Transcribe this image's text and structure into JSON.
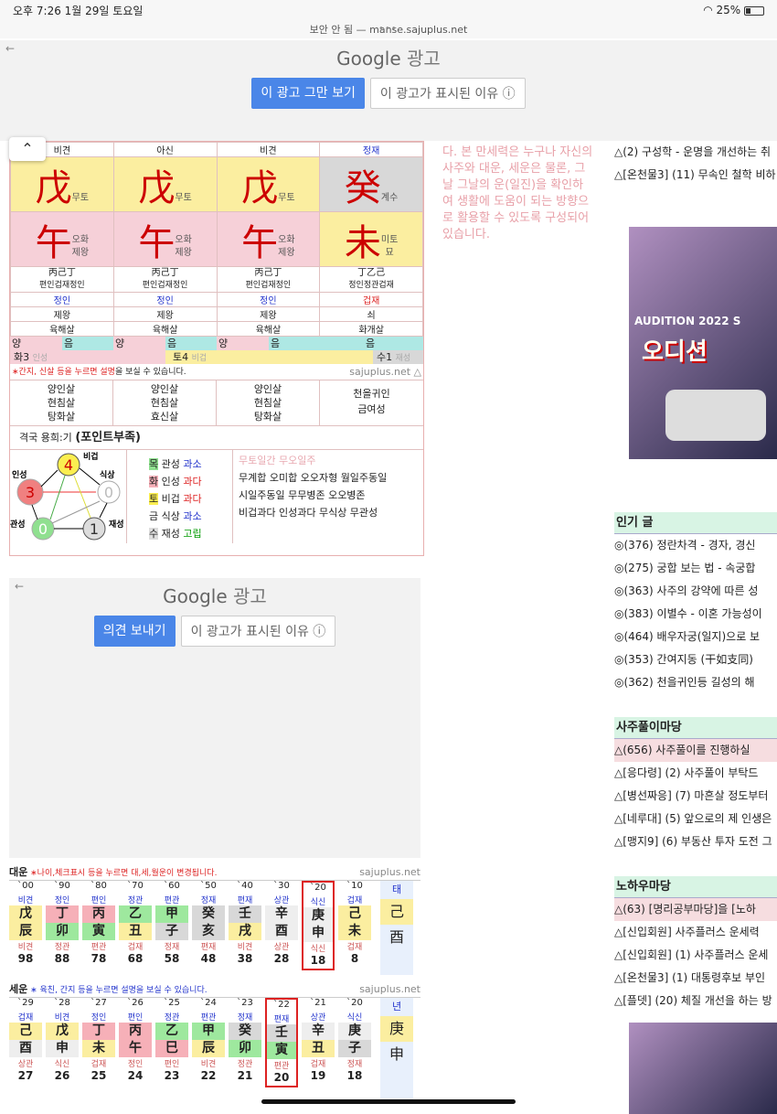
{
  "status": {
    "time": "오후 7:26",
    "date": "1월 29일 토요일",
    "battery": "25%",
    "wifi_icon": "wifi-icon"
  },
  "urlbar": {
    "text": "보안 안 됨 — manse.sajuplus.net"
  },
  "ad_top": {
    "google": "Google",
    "ad_label": "광고",
    "stop_button": "이 광고 그만 보기",
    "why_button": "이 광고가 표시된 이유"
  },
  "ad_mid": {
    "google": "Google",
    "ad_label": "광고",
    "feedback_button": "의견 보내기",
    "why_button": "이 광고가 표시된 이유"
  },
  "pillars": {
    "top_labels": [
      "비견",
      "아신",
      "비견",
      "정재"
    ],
    "stems": [
      {
        "char": "戊",
        "sub": "무토"
      },
      {
        "char": "戊",
        "sub": "무토"
      },
      {
        "char": "戊",
        "sub": "무토"
      },
      {
        "char": "癸",
        "sub": "계수"
      }
    ],
    "branches": [
      {
        "char": "午",
        "sub1": "오화",
        "sub2": "제왕"
      },
      {
        "char": "午",
        "sub1": "오화",
        "sub2": "제왕"
      },
      {
        "char": "午",
        "sub1": "오화",
        "sub2": "제왕"
      },
      {
        "char": "未",
        "sub1": "미토",
        "sub2": "묘"
      }
    ],
    "hidden": [
      "丙己丁",
      "丙己丁",
      "丙己丁",
      "丁乙己"
    ],
    "hidden_sub": [
      "편인겁재정인",
      "편인겁재정인",
      "편인겁재정인",
      "정인정관겁재"
    ],
    "row_a": [
      "정인",
      "정인",
      "정인",
      "겁재"
    ],
    "row_b": [
      "제왕",
      "제왕",
      "제왕",
      "쇠"
    ],
    "row_c": [
      "육해살",
      "육해살",
      "육해살",
      "화개살"
    ],
    "yinyang": [
      "양",
      "음",
      "양",
      "음",
      "양",
      "음",
      "음"
    ],
    "elem_bar": [
      "화3",
      "인성",
      "토4",
      "비겁",
      "수1",
      "재성"
    ]
  },
  "note": {
    "prefix": "∗간지, 신살 등을 누르면 ",
    "link": "설명",
    "suffix": "을 보실 수 있습니다.",
    "site": "sajuplus.net"
  },
  "sinsal": [
    [
      "양인살",
      "현침살",
      "탕화살"
    ],
    [
      "양인살",
      "현침살",
      "효신살"
    ],
    [
      "양인살",
      "현침살",
      "탕화살"
    ],
    [
      "천을귀인",
      "금여성"
    ]
  ],
  "gyeokguk": {
    "label": "격국  용희:기",
    "value": "(포인트부족)"
  },
  "elements_table": [
    {
      "el": "목",
      "name": "관성",
      "state": "과소"
    },
    {
      "el": "화",
      "name": "인성",
      "state": "과다"
    },
    {
      "el": "토",
      "name": "비겁",
      "state": "과다"
    },
    {
      "el": "금",
      "name": "식상",
      "state": "과소"
    },
    {
      "el": "수",
      "name": "재성",
      "state": "고립"
    }
  ],
  "pattern_title": "무토일간 무오일주",
  "patterns": [
    "무계합 오미합 오오자형 월일주동일",
    "시일주동일 무무병존 오오병존",
    "비겁과다 인성과다 무식상 무관성"
  ],
  "diagram": {
    "labels": [
      "비겁",
      "식상",
      "재성",
      "관성",
      "인성"
    ],
    "counts": [
      "4",
      "0",
      "1",
      "0",
      "3"
    ]
  },
  "side_text": "다. 본 만세력은 누구나 자신의 사주와 대운, 세운은 물론, 그날 그날의 운(일진)을 확인하여 생활에 도움이 되는 방향으로 활용할 수 있도록 구성되어 있습니다.",
  "right_links_top": [
    "△(2) 구성학 - 운명을 개선하는 취",
    "△[온천물3] (11) 무속인 철학 비하"
  ],
  "popular": {
    "title": "인기 글",
    "items": [
      "◎(376) 정란차격 - 경자, 경신",
      "◎(275) 궁합 보는 법 - 속궁합",
      "◎(363) 사주의 강약에 따른 성",
      "◎(383) 이별수 - 이혼 가능성이",
      "◎(464) 배우자궁(일지)으로 보",
      "◎(353) 간여지동 (干如支同)",
      "◎(362) 천을귀인등 길성의 해"
    ]
  },
  "saju_board": {
    "title": "사주풀이마당",
    "items": [
      "△(656) 사주풀이를 진행하실",
      "△[응다령] (2) 사주풀이 부탁드",
      "△[병선짜응] (7) 마흔살 정도부터",
      "△[네루대] (5) 앞으로의 제 인생은",
      "△[맹지9] (6) 부동산 투자 도전 그"
    ]
  },
  "knowhow_board": {
    "title": "노하우마당",
    "items": [
      "△(63) [명리공부마당]을 [노하",
      "△[신입회원] 사주플러스 운세력",
      "△[신입회원] (1) 사주플러스 운세",
      "△[온천물3] (1) 대통령후보 부인",
      "△[플뎃] (20) 체질 개선을 하는 방"
    ]
  },
  "ad_image": {
    "title": "AUDITION 2022 S",
    "logo": "오디션"
  },
  "daeun": {
    "title": "대운",
    "note": "∗나이,체크표시 등을 누르면 대,세,월운이 변경됩니다.",
    "site": "sajuplus.net",
    "cols": [
      {
        "yr": "`00",
        "top": "비견",
        "s": "戊",
        "b": "辰",
        "bot": "비견",
        "age": "98"
      },
      {
        "yr": "`90",
        "top": "정인",
        "s": "丁",
        "b": "卯",
        "bot": "정관",
        "age": "88"
      },
      {
        "yr": "`80",
        "top": "편인",
        "s": "丙",
        "b": "寅",
        "bot": "편관",
        "age": "78"
      },
      {
        "yr": "`70",
        "top": "정관",
        "s": "乙",
        "b": "丑",
        "bot": "겁재",
        "age": "68"
      },
      {
        "yr": "`60",
        "top": "편관",
        "s": "甲",
        "b": "子",
        "bot": "정재",
        "age": "58"
      },
      {
        "yr": "`50",
        "top": "정재",
        "s": "癸",
        "b": "亥",
        "bot": "편재",
        "age": "48"
      },
      {
        "yr": "`40",
        "top": "편재",
        "s": "壬",
        "b": "戌",
        "bot": "비견",
        "age": "38"
      },
      {
        "yr": "`30",
        "top": "상관",
        "s": "辛",
        "b": "酉",
        "bot": "상관",
        "age": "28"
      },
      {
        "yr": "`20",
        "top": "식신",
        "s": "庚",
        "b": "申",
        "bot": "식신",
        "age": "18"
      },
      {
        "yr": "`10",
        "top": "겁재",
        "s": "己",
        "b": "未",
        "bot": "겁재",
        "age": "8"
      }
    ],
    "extra": {
      "label": "태",
      "s": "己",
      "b": "酉"
    }
  },
  "seun": {
    "title": "세운",
    "note": "∗ 육친, 간지 등을 누르면 설명을 보실 수 있습니다.",
    "site": "sajuplus.net",
    "cols": [
      {
        "yr": "`29",
        "top": "겁재",
        "s": "己",
        "b": "酉",
        "bot": "상관",
        "age": "27"
      },
      {
        "yr": "`28",
        "top": "비견",
        "s": "戊",
        "b": "申",
        "bot": "식신",
        "age": "26"
      },
      {
        "yr": "`27",
        "top": "정인",
        "s": "丁",
        "b": "未",
        "bot": "겁재",
        "age": "25"
      },
      {
        "yr": "`26",
        "top": "편인",
        "s": "丙",
        "b": "午",
        "bot": "정인",
        "age": "24"
      },
      {
        "yr": "`25",
        "top": "정관",
        "s": "乙",
        "b": "巳",
        "bot": "편인",
        "age": "23"
      },
      {
        "yr": "`24",
        "top": "편관",
        "s": "甲",
        "b": "辰",
        "bot": "비견",
        "age": "22"
      },
      {
        "yr": "`23",
        "top": "정재",
        "s": "癸",
        "b": "卯",
        "bot": "정관",
        "age": "21"
      },
      {
        "yr": "`22",
        "top": "편재",
        "s": "壬",
        "b": "寅",
        "bot": "편관",
        "age": "20"
      },
      {
        "yr": "`21",
        "top": "상관",
        "s": "辛",
        "b": "丑",
        "bot": "겁재",
        "age": "19"
      },
      {
        "yr": "`20",
        "top": "식신",
        "s": "庚",
        "b": "子",
        "bot": "정재",
        "age": "18"
      }
    ],
    "extra": {
      "label": "년",
      "s": "庚",
      "b": "申"
    }
  }
}
